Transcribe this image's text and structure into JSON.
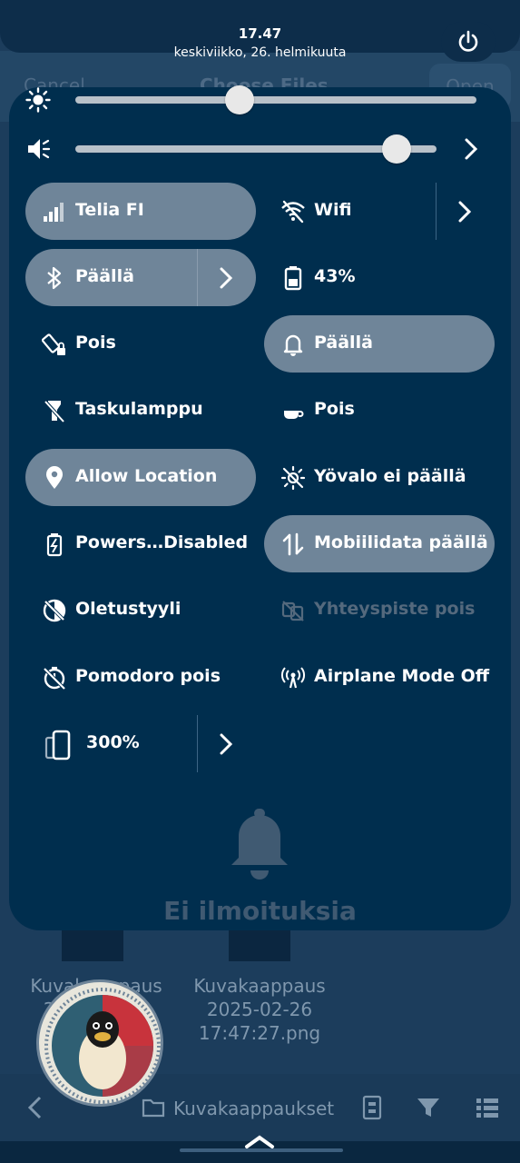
{
  "background_app": {
    "cancel_label": "Cancel",
    "title": "Choose Files",
    "open_label": "Open",
    "files": [
      {
        "caption": "Kuvakaappaus 2025-02-26"
      },
      {
        "caption": "Kuvakaappaus 2025-02-26 17:47:27.png"
      }
    ],
    "folder_label": "Kuvakaappaukset"
  },
  "status": {
    "time": "17.47",
    "date": "keskiviikko, 26. helmikuuta"
  },
  "sliders": {
    "brightness": {
      "icon": "brightness-icon",
      "level": 0.41
    },
    "volume": {
      "icon": "volume-icon",
      "level": 0.89
    }
  },
  "tiles": [
    {
      "id": "mobile",
      "label": "Telia FI",
      "icon": "signal-icon",
      "active": true
    },
    {
      "id": "wifi",
      "label": "Wifi",
      "icon": "wifi-off-icon",
      "active": false
    },
    {
      "id": "bluetooth",
      "label": "Päällä",
      "icon": "bluetooth-icon",
      "active": true
    },
    {
      "id": "battery",
      "label": "43%",
      "icon": "battery-icon",
      "active": false
    },
    {
      "id": "rotation",
      "label": "Pois",
      "icon": "rotation-lock-icon",
      "active": false
    },
    {
      "id": "notifications",
      "label": "Päällä",
      "icon": "bell-icon",
      "active": true
    },
    {
      "id": "flashlight",
      "label": "Taskulamppu",
      "icon": "flashlight-icon",
      "active": false
    },
    {
      "id": "caffeine",
      "label": "Pois",
      "icon": "coffee-icon",
      "active": false
    },
    {
      "id": "location",
      "label": "Allow Location",
      "icon": "location-icon",
      "active": true
    },
    {
      "id": "nightlight",
      "label": "Yövalo ei päällä",
      "icon": "night-light-icon",
      "active": false
    },
    {
      "id": "powersave",
      "label": "Powers…Disabled",
      "icon": "battery-saver-icon",
      "active": false
    },
    {
      "id": "mobiledata",
      "label": "Mobiilidata päällä",
      "icon": "data-arrows-icon",
      "active": true
    },
    {
      "id": "style",
      "label": "Oletustyyli",
      "icon": "style-icon",
      "active": false
    },
    {
      "id": "hotspot",
      "label": "Yhteyspiste pois",
      "icon": "hotspot-icon",
      "active": false
    },
    {
      "id": "pomodoro",
      "label": "Pomodoro pois",
      "icon": "timer-off-icon",
      "active": false
    },
    {
      "id": "airplane",
      "label": "Airplane Mode Off",
      "icon": "antenna-icon",
      "active": false
    },
    {
      "id": "scale",
      "label": "300%",
      "icon": "phone-scale-icon",
      "active": false
    }
  ],
  "notifications": {
    "empty_label": "Ei ilmoituksia"
  },
  "colors": {
    "panel": "#002e4e",
    "tile_active": "#6f8599",
    "accent_white": "#ffffff"
  }
}
